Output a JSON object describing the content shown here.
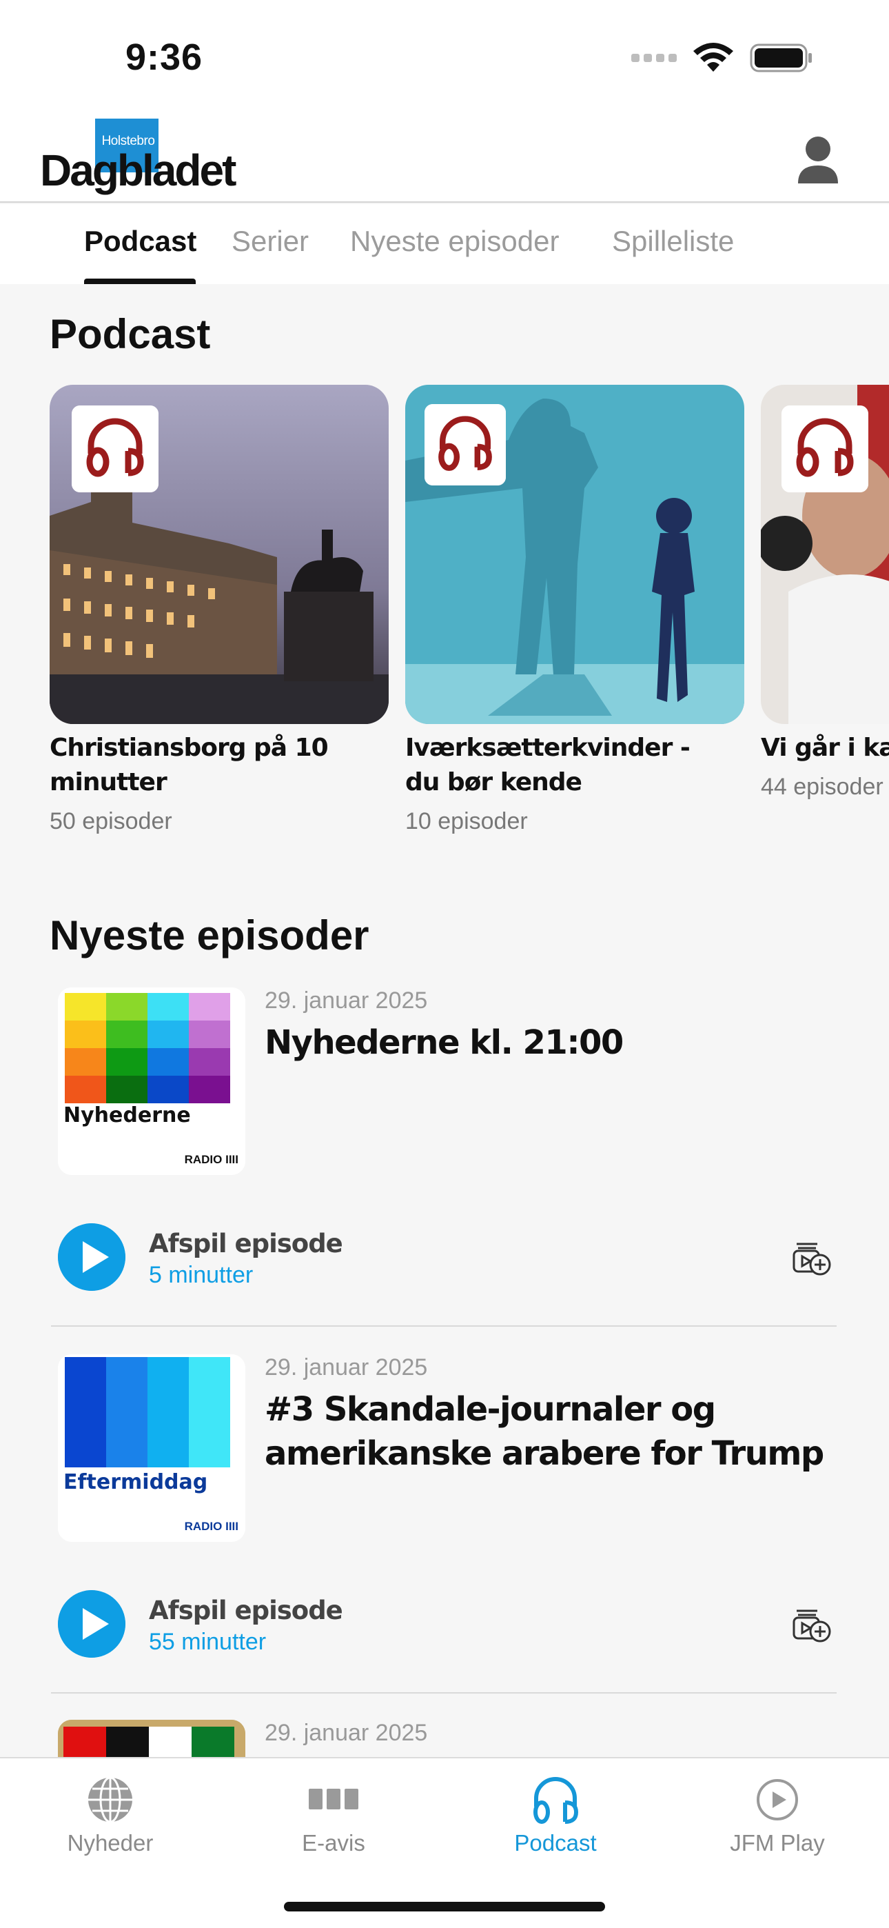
{
  "status_bar": {
    "time": "9:36"
  },
  "header": {
    "logo_top": "Holstebro",
    "logo_main": "Dagbladet",
    "brand_color": "#1e8fd4"
  },
  "tabs": [
    {
      "label": "Podcast",
      "active": true
    },
    {
      "label": "Serier",
      "active": false
    },
    {
      "label": "Nyeste episoder",
      "active": false
    },
    {
      "label": "Spilleliste",
      "active": false
    }
  ],
  "podcast_section": {
    "title": "Podcast",
    "cards": [
      {
        "title": "Christiansborg på 10 minutter",
        "count": "50 episoder",
        "icon": "headphones-logo-icon"
      },
      {
        "title": "Iværksætterkvinder - du bør kende",
        "count": "10 episoder",
        "icon": "headphones-logo-icon"
      },
      {
        "title": "Vi går i kæl",
        "count": "44 episoder",
        "icon": "headphones-logo-icon"
      }
    ]
  },
  "episodes_section": {
    "title": "Nyeste episoder",
    "play_label": "Afspil episode",
    "items": [
      {
        "date": "29. januar 2025",
        "title": "Nyhederne kl. 21:00",
        "thumb_label": "Nyhederne",
        "thumb_brand": "RADIO IIII",
        "duration": "5 minutter"
      },
      {
        "date": "29. januar 2025",
        "title": "#3 Skandale-journaler og amerikanske arabere for Trump",
        "thumb_label": "Eftermiddag",
        "thumb_brand": "RADIO IIII",
        "duration": "55 minutter"
      },
      {
        "date": "29. januar 2025"
      }
    ]
  },
  "bottom_nav": [
    {
      "label": "Nyheder",
      "icon": "globe-icon",
      "active": false
    },
    {
      "label": "E-avis",
      "icon": "newspaper-icon",
      "active": false
    },
    {
      "label": "Podcast",
      "icon": "headphones-icon",
      "active": true
    },
    {
      "label": "JFM Play",
      "icon": "play-circle-icon",
      "active": false
    }
  ],
  "colors": {
    "accent": "#0e9ee4",
    "podcast_badge": "#9b1c1c"
  }
}
